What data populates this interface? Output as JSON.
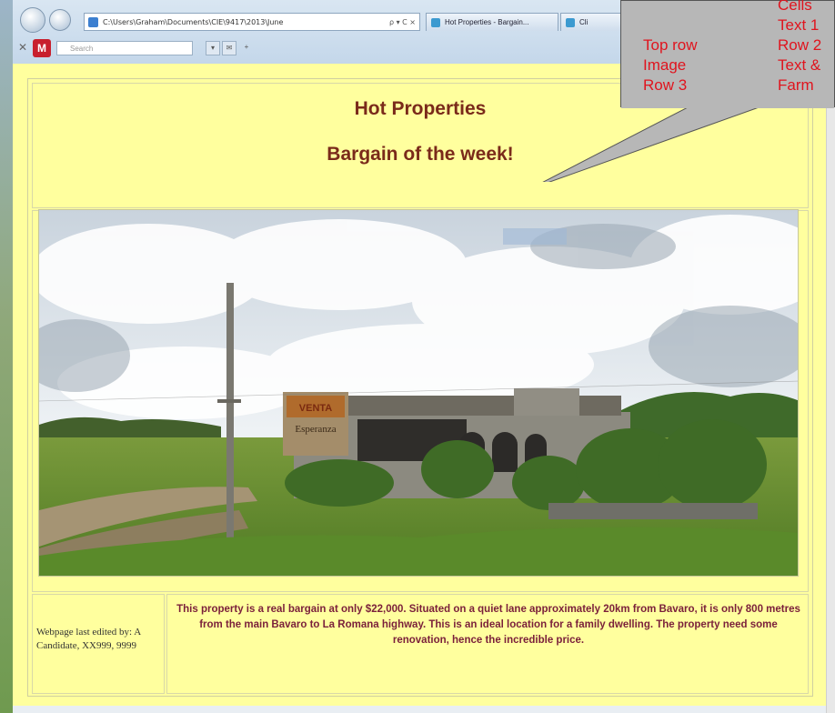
{
  "browser": {
    "address": "C:\\Users\\Graham\\Documents\\CIE\\9417\\2013\\June",
    "address_controls": "ρ ▾ C ×",
    "tabs": [
      {
        "label": "Hot Properties - Bargain..."
      },
      {
        "label": "Cli"
      }
    ],
    "search_placeholder": "Search"
  },
  "page": {
    "title": "Hot Properties",
    "subtitle": "Bargain of the week!",
    "footer_left": "Webpage last edited by: A Candidate, XX999, 9999",
    "description": "This property is a real bargain at only $22,000. Situated on a quiet lane approximately 20km from Bavaro, it is only 800 metres from the main Bavaro to La Romana highway. This is an ideal location for a family dwelling. The property need some renovation, hence the incredible price."
  },
  "photo": {
    "sign_top": "VENTA",
    "sign_bottom": "Esperanza"
  },
  "callout": {
    "left_items": [
      "Top row",
      "Image",
      "Row 3"
    ],
    "right_items": [
      "Cells",
      "Text 1",
      "Row 2",
      "Text &",
      "Farm"
    ]
  },
  "colors": {
    "page_background": "#ffff9e",
    "heading": "#7a2a1a",
    "description": "#7a1f3a",
    "callout_text": "#e0141e",
    "callout_background": "#b7b7b7"
  }
}
